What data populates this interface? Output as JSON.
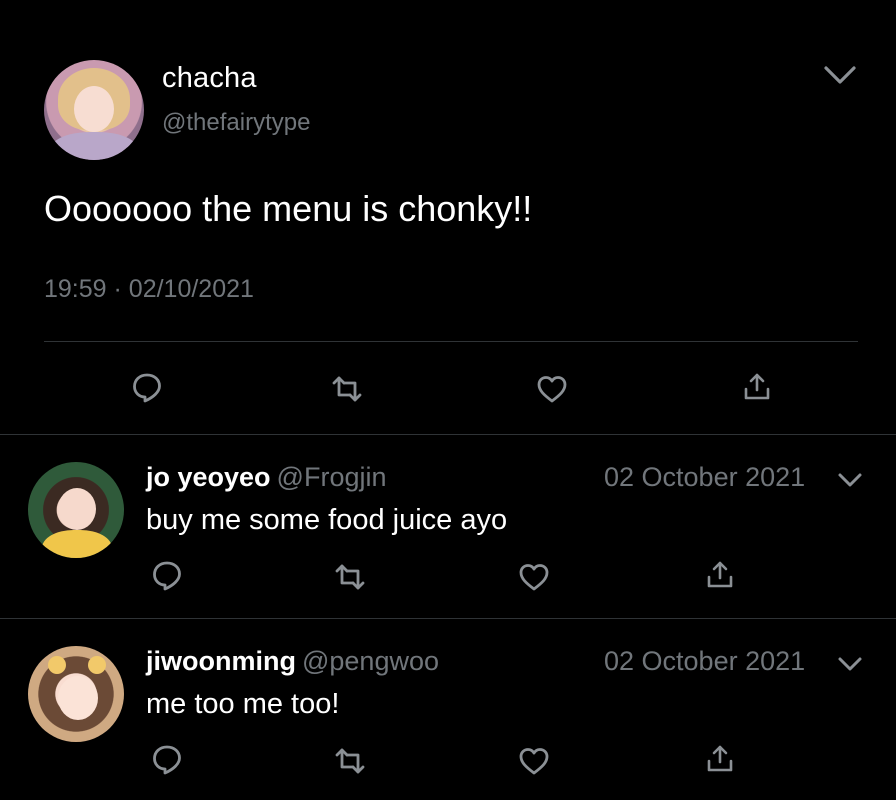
{
  "main_tweet": {
    "author_name": "chacha",
    "author_handle": "@thefairytype",
    "text": "Ooooooo the menu is chonky!!",
    "time": "19:59",
    "separator": "·",
    "date": "02/10/2021",
    "actions": [
      "reply-icon",
      "retweet-icon",
      "like-icon",
      "share-icon"
    ]
  },
  "replies": [
    {
      "author_name": "jo yeoyeo",
      "author_handle": "@Frogjin",
      "date": "02 October 2021",
      "text": "buy me some food juice ayo",
      "actions": [
        "reply-icon",
        "retweet-icon",
        "like-icon",
        "share-icon"
      ]
    },
    {
      "author_name": "jiwoonming",
      "author_handle": "@pengwoo",
      "date": "02 October 2021",
      "text": "me too me too!",
      "actions": [
        "reply-icon",
        "retweet-icon",
        "like-icon",
        "share-icon"
      ]
    }
  ],
  "colors": {
    "background": "#000000",
    "primary_text": "#ffffff",
    "secondary_text": "#71767b",
    "divider": "#2f3336",
    "icon": "#71767b"
  }
}
